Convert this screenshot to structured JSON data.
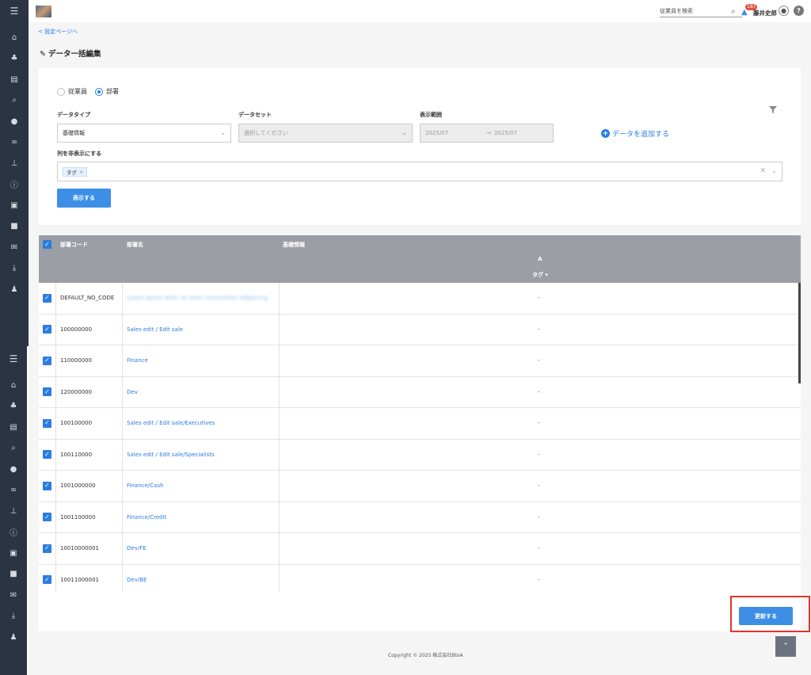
{
  "sidebar": {
    "menu_icon": "☰",
    "items": [
      {
        "icon": "home-icon",
        "glyph": "⌂"
      },
      {
        "icon": "org-chart-icon",
        "glyph": "♣"
      },
      {
        "icon": "document-icon",
        "glyph": "▤"
      },
      {
        "icon": "search-icon",
        "glyph": "⌕"
      },
      {
        "icon": "chat-icon",
        "glyph": "●"
      },
      {
        "icon": "link-icon",
        "glyph": "∞"
      },
      {
        "icon": "analytics-icon",
        "glyph": "⊥"
      },
      {
        "icon": "info-icon",
        "glyph": "ⓘ"
      },
      {
        "icon": "contact-icon",
        "glyph": "▣"
      },
      {
        "icon": "book-icon",
        "glyph": "■"
      },
      {
        "icon": "mail-icon",
        "glyph": "✉"
      },
      {
        "icon": "download-icon",
        "glyph": "⤓"
      },
      {
        "icon": "user-settings-icon",
        "glyph": "♟"
      }
    ]
  },
  "header": {
    "search_placeholder": "従業員を検索",
    "notification_count": "187",
    "user_name": "藤井史郎",
    "help": "?"
  },
  "nav": {
    "back_link": "< 設定ページへ",
    "page_title": "データ一括編集"
  },
  "filters": {
    "radio_employee": "従業員",
    "radio_department": "部署",
    "selected_radio": "部署",
    "data_type_label": "データタイプ",
    "data_type_value": "基礎情報",
    "data_set_label": "データセット",
    "data_set_placeholder": "選択してください",
    "display_range_label": "表示範囲",
    "range_from": "2025/07",
    "range_to": "2025/07",
    "range_arrow": "→",
    "add_data_label": "データを追加する",
    "hide_columns_label": "列を非表示にする",
    "hidden_tag": "タグ",
    "show_button": "表示する"
  },
  "table": {
    "headers": {
      "code": "部署コード",
      "name": "部署名",
      "basic_info": "基礎情報",
      "group": "A",
      "tag_col": "タグ ▾"
    },
    "rows": [
      {
        "code": "DEFAULT_NO_CODE",
        "name": "Lorem ipsum dolor sit amet consectetur adipiscing",
        "value": "-"
      },
      {
        "code": "100000000",
        "name": "Sales edit / Edit sale",
        "value": "-"
      },
      {
        "code": "110000000",
        "name": "Finance",
        "value": "-"
      },
      {
        "code": "120000000",
        "name": "Dev",
        "value": "-"
      },
      {
        "code": "100100000",
        "name": "Sales edit / Edit sale/Executives",
        "value": "-"
      },
      {
        "code": "100110000",
        "name": "Sales edit / Edit sale/Specialists",
        "value": "-"
      },
      {
        "code": "1001000000",
        "name": "Finance/Cash",
        "value": "-"
      },
      {
        "code": "1001100000",
        "name": "Finance/Credit",
        "value": "-"
      },
      {
        "code": "10010000001",
        "name": "Dev/FE",
        "value": "-"
      },
      {
        "code": "10011000001",
        "name": "Dev/BE",
        "value": "-"
      }
    ]
  },
  "actions": {
    "update_button": "更新する",
    "highlight_color": "#e0342c"
  },
  "footer": {
    "copyright": "Copyright © 2025 株式会社BtoA",
    "scroll_top": "⌃"
  },
  "colors": {
    "sidebar": "#2b3442",
    "accent": "#3d8fe6",
    "table_header": "#9c9ea6",
    "page_bg": "#f5f5f6"
  }
}
